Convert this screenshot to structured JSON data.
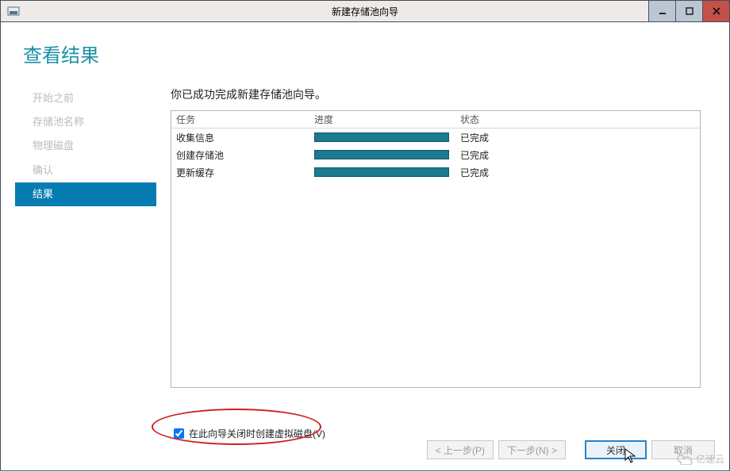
{
  "window": {
    "title": "新建存储池向导"
  },
  "page": {
    "title": "查看结果"
  },
  "sidebar": {
    "items": [
      {
        "label": "开始之前"
      },
      {
        "label": "存储池名称"
      },
      {
        "label": "物理磁盘"
      },
      {
        "label": "确认"
      },
      {
        "label": "结果"
      }
    ],
    "active_index": 4
  },
  "main": {
    "message": "你已成功完成新建存储池向导。",
    "columns": {
      "task": "任务",
      "progress": "进度",
      "status": "状态"
    },
    "rows": [
      {
        "task": "收集信息",
        "status": "已完成"
      },
      {
        "task": "创建存储池",
        "status": "已完成"
      },
      {
        "task": "更新缓存",
        "status": "已完成"
      }
    ]
  },
  "checkbox": {
    "checked": true,
    "label": "在此向导关闭时创建虚拟磁盘(V)"
  },
  "footer": {
    "prev": "< 上一步(P)",
    "next": "下一步(N) >",
    "close": "关闭",
    "cancel": "取消"
  },
  "watermark": "亿速云"
}
